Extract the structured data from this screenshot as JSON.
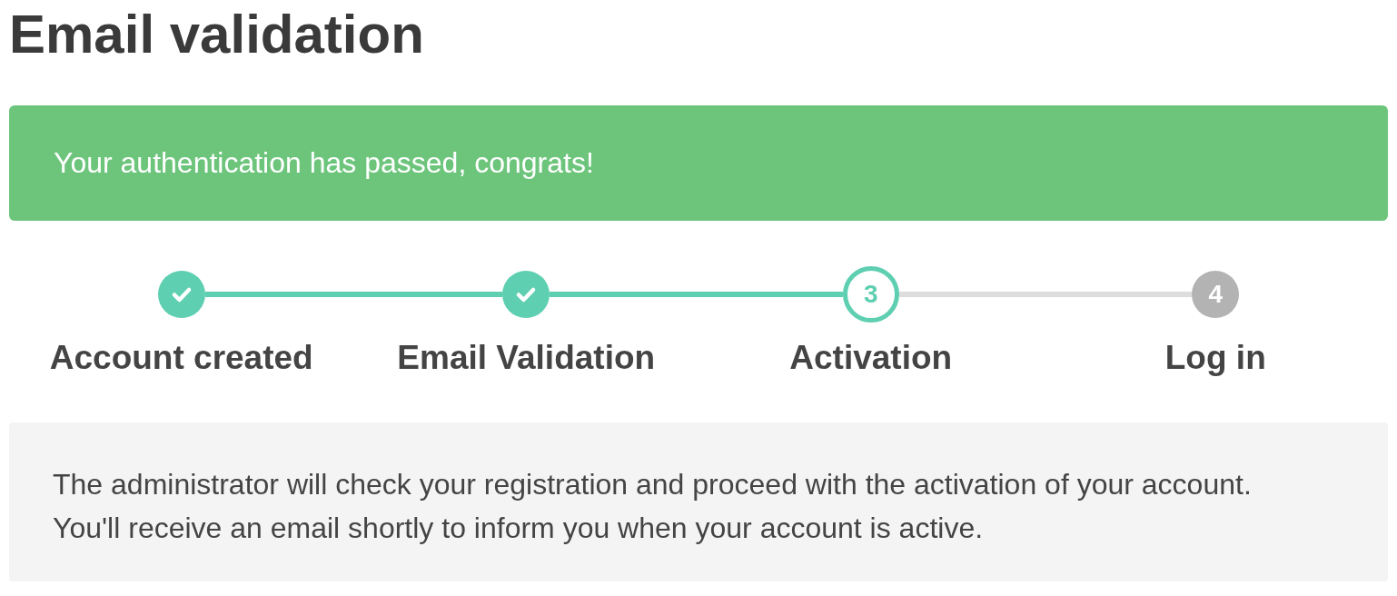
{
  "title": "Email validation",
  "alert": {
    "text": "Your authentication has passed, congrats!"
  },
  "steps": [
    {
      "label": "Account created",
      "done": true,
      "current": false
    },
    {
      "label": "Email Validation",
      "done": true,
      "current": false
    },
    {
      "label": "Activation",
      "done": false,
      "current": true,
      "number": "3"
    },
    {
      "label": "Log in",
      "done": false,
      "current": false,
      "number": "4"
    }
  ],
  "info": {
    "lines": [
      "The administrator will check your registration and proceed with the activation of your account.",
      "You'll receive an email shortly to inform you when your account is active."
    ]
  }
}
